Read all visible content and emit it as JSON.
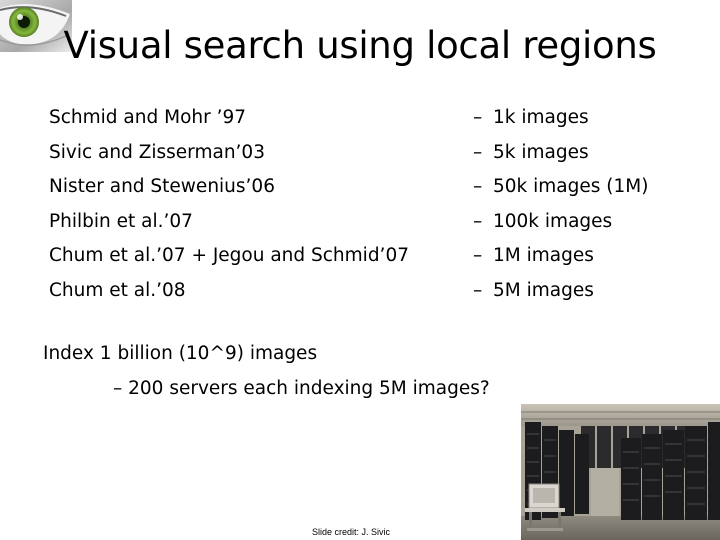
{
  "slide": {
    "title": "Visual search using local regions",
    "references": [
      "Schmid and Mohr ’97",
      "Sivic and Zisserman’03",
      "Nister and Stewenius’06",
      "Philbin et al.’07",
      "Chum et al.’07 + Jegou and Schmid’07",
      "Chum et al.’08"
    ],
    "dataset_sizes": [
      "1k images",
      "5k images",
      "50k images (1M)",
      "100k images",
      "1M images",
      "5M images"
    ],
    "dash": "–",
    "index_text": "Index 1 billion (10^9) images",
    "servers_text": "– 200 servers each indexing 5M images?",
    "credit": "Slide credit: J. Sivic"
  },
  "colors": {
    "background": "#ffffff",
    "text": "#000000",
    "eye_iris": "#7fae3a"
  }
}
